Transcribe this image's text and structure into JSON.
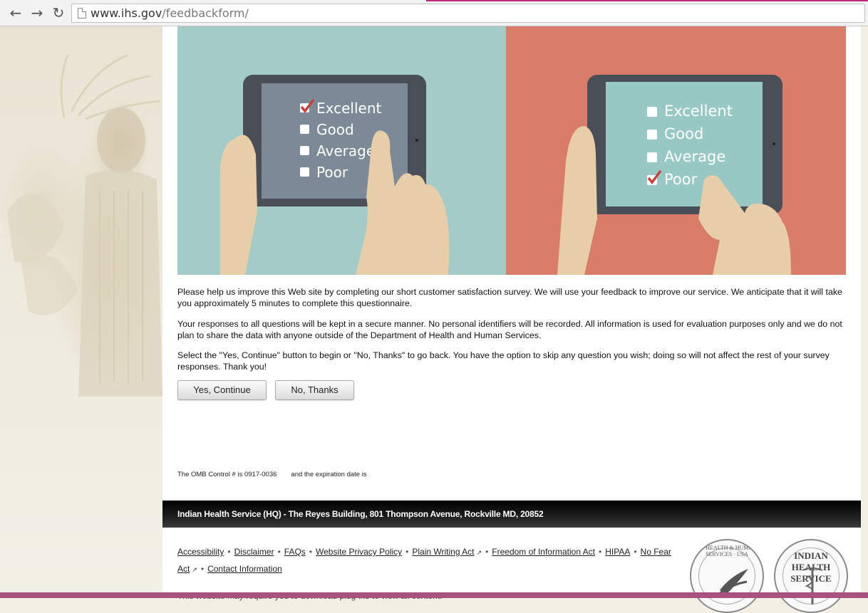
{
  "browser": {
    "back_icon": "arrow-left-icon",
    "forward_icon": "arrow-right-icon",
    "reload_icon": "reload-icon",
    "url_host": "www.ihs.gov",
    "url_path": "/feedbackform/"
  },
  "hero": {
    "left_options": [
      "Excellent",
      "Good",
      "Average",
      "Poor"
    ],
    "left_checked": "Excellent",
    "right_options": [
      "Excellent",
      "Good",
      "Average",
      "Poor"
    ],
    "right_checked": "Poor",
    "colors": {
      "left_bg": "#a3cbc8",
      "right_bg": "#d97c6a",
      "check": "#c9403a",
      "skin": "#e8cda9"
    }
  },
  "intro": {
    "p1": "Please help us improve this Web site by completing our short customer satisfaction survey. We will use your feedback to improve our service. We anticipate that it will take you approximately 5 minutes to complete this questionnaire.",
    "p2": "Your responses to all questions will be kept in a secure manner. No personal identifiers will be recorded. All information is used for evaluation purposes only and we do not plan to share the data with anyone outside of the Department of Health and Human Services.",
    "p3": "Select the \"Yes, Continue\" button to begin or \"No, Thanks\" to go back. You have the option to skip any question you wish; doing so will not affect the rest of your survey responses. Thank you!"
  },
  "buttons": {
    "yes": "Yes, Continue",
    "no": "No, Thanks"
  },
  "omb": {
    "control": "The OMB Control # is 0917-0036",
    "expiration": "and the expiration date is"
  },
  "footer": {
    "address": "Indian Health Service (HQ) - The Reyes Building, 801 Thompson Avenue, Rockville MD, 20852",
    "links": {
      "accessibility": "Accessibility",
      "disclaimer": "Disclaimer",
      "faqs": "FAQs",
      "privacy": "Website Privacy Policy",
      "plain_writing": "Plain Writing Act",
      "foia": "Freedom of Information Act",
      "hipaa": "HIPAA",
      "no_fear_1": "No Fear",
      "no_fear_2": "Act",
      "contact": "Contact Information"
    },
    "cut_text": "This website may require you to download plug-ins to view all content.",
    "seal_hhs_text": "OF HEALTH & HUMAN SERVICES · USA",
    "seal_ihs_text": "INDIAN HEALTH SERVICE"
  }
}
